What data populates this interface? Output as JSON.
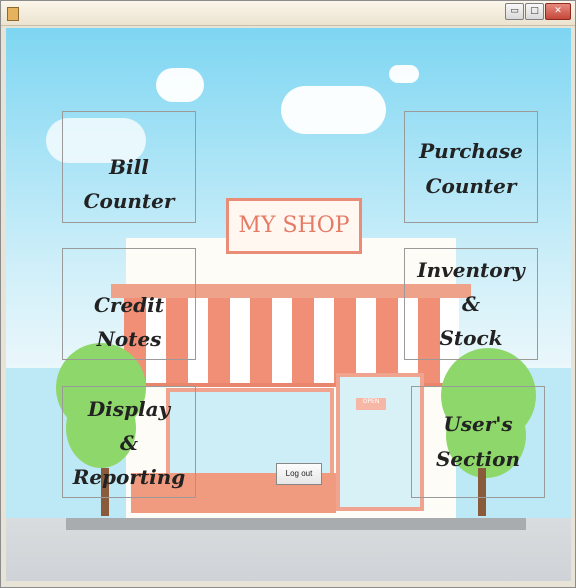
{
  "window": {
    "title": "",
    "controls": {
      "minimize": "▭",
      "maximize": "□",
      "close": "✕"
    }
  },
  "scene": {
    "sign_text": "MY SHOP",
    "door_sign": "OPEN"
  },
  "tiles": [
    {
      "id": "bill-counter",
      "lines": [
        "Bill Counter"
      ]
    },
    {
      "id": "purchase-counter",
      "lines": [
        "Purchase",
        "Counter"
      ]
    },
    {
      "id": "credit-notes",
      "lines": [
        "Credit Notes"
      ]
    },
    {
      "id": "inventory-stock",
      "lines": [
        "Inventory",
        "&",
        "Stock"
      ]
    },
    {
      "id": "display-reporting",
      "lines": [
        "Display",
        "&",
        "Reporting"
      ]
    },
    {
      "id": "users-section",
      "lines": [
        "User's",
        "Section"
      ]
    }
  ],
  "logout_label": "Log out"
}
